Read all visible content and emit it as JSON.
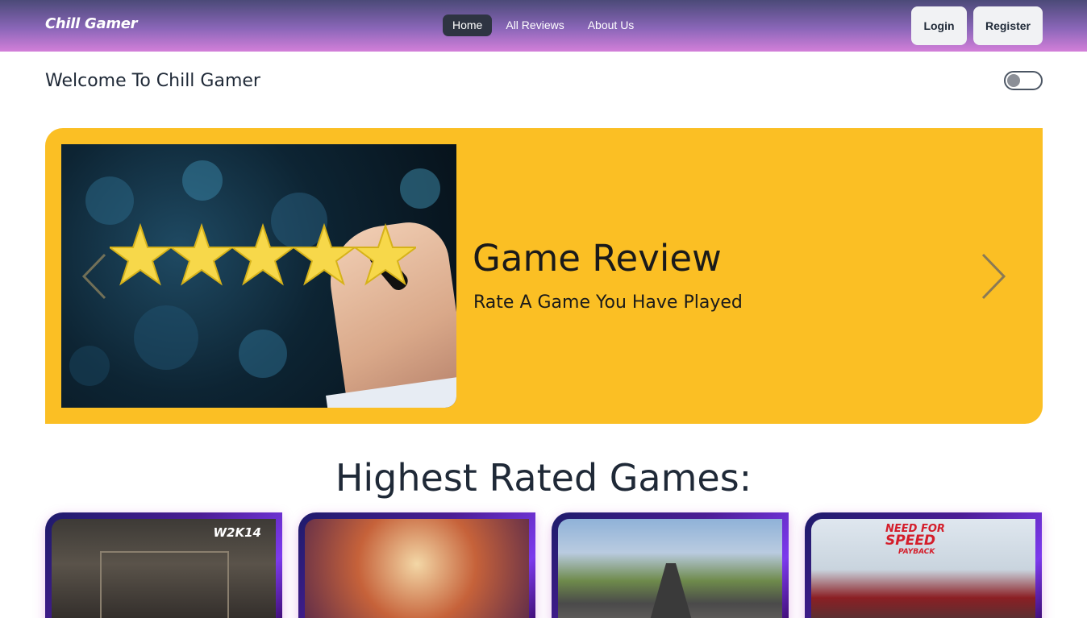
{
  "navbar": {
    "brand": "Chill Gamer",
    "links": [
      {
        "label": "Home",
        "active": true
      },
      {
        "label": "All Reviews",
        "active": false
      },
      {
        "label": "About Us",
        "active": false
      }
    ],
    "login_label": "Login",
    "register_label": "Register"
  },
  "welcome": {
    "text": "Welcome To Chill Gamer",
    "theme_toggle_on": false
  },
  "banner": {
    "title": "Game Review",
    "subtitle": "Rate A Game You Have Played",
    "prev_icon": "chevron-left-icon",
    "next_icon": "chevron-right-icon",
    "background_color": "#fbbf24"
  },
  "highest_rated": {
    "title": "Highest Rated Games:",
    "cards": [
      {
        "badge": "W2K14"
      },
      {
        "badge": ""
      },
      {
        "badge": ""
      },
      {
        "badge_line1": "NEED FOR",
        "badge_line2": "SPEED",
        "badge_line3": "PAYBACK"
      }
    ]
  },
  "colors": {
    "accent_dark": "#2e3442",
    "banner_yellow": "#fbbf24",
    "nav_gradient_top": "#4b4a78",
    "nav_gradient_bottom": "#d37fd9"
  }
}
